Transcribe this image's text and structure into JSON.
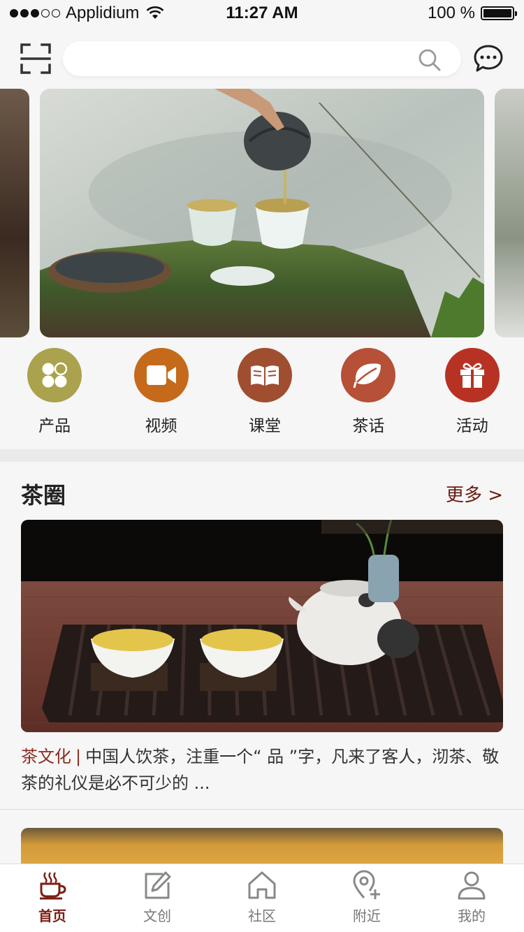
{
  "status_bar": {
    "carrier": "Applidium",
    "time": "11:27 AM",
    "battery": "100 %"
  },
  "search": {
    "placeholder": ""
  },
  "categories": [
    {
      "label": "产品",
      "icon": "clover-icon",
      "color": "#a9a04a"
    },
    {
      "label": "视频",
      "icon": "video-camera-icon",
      "color": "#c46a1a"
    },
    {
      "label": "课堂",
      "icon": "book-icon",
      "color": "#a04e30"
    },
    {
      "label": "茶话",
      "icon": "tea-leaf-icon",
      "color": "#b65036"
    },
    {
      "label": "活动",
      "icon": "gift-icon",
      "color": "#b83224"
    }
  ],
  "section": {
    "title": "茶圈",
    "more": "更多 >"
  },
  "article": {
    "tag": "茶文化",
    "separator": "|",
    "text": "中国人饮茶，注重一个“ 品 ”字，凡来了客人，沏茶、敬茶的礼仪是必不可少的 ..."
  },
  "tabbar": [
    {
      "label": "首页",
      "icon": "tea-cup-icon",
      "active": true
    },
    {
      "label": "文创",
      "icon": "edit-icon",
      "active": false
    },
    {
      "label": "社区",
      "icon": "home-icon",
      "active": false
    },
    {
      "label": "附近",
      "icon": "location-add-icon",
      "active": false
    },
    {
      "label": "我的",
      "icon": "user-icon",
      "active": false
    }
  ],
  "colors": {
    "accent": "#7a1f14",
    "tag": "#8b2d20",
    "background": "#f6f6f6"
  }
}
